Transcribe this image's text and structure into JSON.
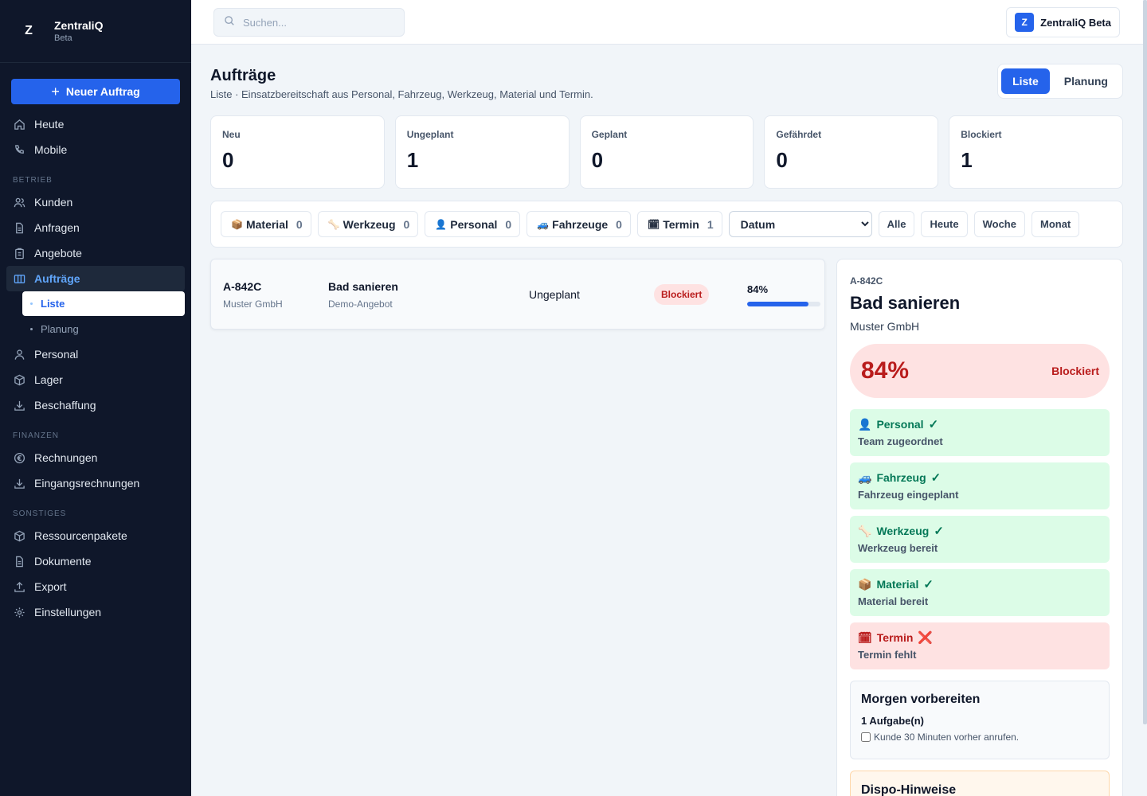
{
  "brand": {
    "logo_letter": "Z",
    "name": "ZentraliQ",
    "sub": "Beta"
  },
  "sidebar": {
    "new_button": "Neuer Auftrag",
    "top_items": [
      {
        "label": "Heute",
        "icon": "home-icon"
      },
      {
        "label": "Mobile",
        "icon": "phone-icon"
      }
    ],
    "sections": [
      {
        "title": "Betrieb",
        "items": [
          "Kunden",
          "Anfragen",
          "Angebote",
          "Aufträge"
        ]
      },
      {
        "title": "Finanzen",
        "items": [
          "Rechnungen",
          "Eingangsrechnungen"
        ]
      },
      {
        "title": "Sonstiges",
        "items": [
          "Ressourcenpakete",
          "Dokumente",
          "Export",
          "Einstellungen"
        ]
      }
    ],
    "subitems": [
      "Liste",
      "Planung"
    ],
    "more_items": [
      "Personal",
      "Lager",
      "Beschaffung"
    ],
    "active_item": "Aufträge",
    "active_subitem": "Liste"
  },
  "topbar": {
    "search_placeholder": "Suchen...",
    "workspace_avatar": "Z",
    "workspace_name": "ZentraliQ Beta"
  },
  "page": {
    "title": "Aufträge",
    "subtitle": "Liste · Einsatzbereitschaft aus Personal, Fahrzeug, Werkzeug, Material und Termin.",
    "view_toggle": [
      "Liste",
      "Planung"
    ],
    "active_view": "Liste"
  },
  "stats": [
    {
      "label": "Neu",
      "value": "0"
    },
    {
      "label": "Ungeplant",
      "value": "1"
    },
    {
      "label": "Geplant",
      "value": "0"
    },
    {
      "label": "Gefährdet",
      "value": "0"
    },
    {
      "label": "Blockiert",
      "value": "1"
    }
  ],
  "filters": {
    "chips": [
      {
        "emoji": "📦",
        "label": "Material",
        "count": "0"
      },
      {
        "emoji": "🦴",
        "label": "Werkzeug",
        "count": "0"
      },
      {
        "emoji": "👤",
        "label": "Personal",
        "count": "0"
      },
      {
        "emoji": "🚙",
        "label": "Fahrzeuge",
        "count": "0"
      },
      {
        "emoji": "🗓",
        "label": "Termin",
        "count": "1"
      }
    ],
    "date_select": "Datum",
    "ranges": [
      "Alle",
      "Heute",
      "Woche",
      "Monat"
    ]
  },
  "orders": [
    {
      "id": "A-842C",
      "customer": "Muster GmbH",
      "title": "Bad sanieren",
      "source": "Demo-Angebot",
      "status": "Ungeplant",
      "badge": "Blockiert",
      "progress_label": "84%",
      "progress": 84
    }
  ],
  "detail": {
    "id": "A-842C",
    "title": "Bad sanieren",
    "customer": "Muster GmbH",
    "score": "84%",
    "score_label": "Blockiert",
    "checks": [
      {
        "emoji": "👤",
        "label": "Personal",
        "mark": "✓",
        "state": "ok",
        "sub": "Team zugeordnet"
      },
      {
        "emoji": "🚙",
        "label": "Fahrzeug",
        "mark": "✓",
        "state": "ok",
        "sub": "Fahrzeug eingeplant"
      },
      {
        "emoji": "🦴",
        "label": "Werkzeug",
        "mark": "✓",
        "state": "ok",
        "sub": "Werkzeug bereit"
      },
      {
        "emoji": "📦",
        "label": "Material",
        "mark": "✓",
        "state": "ok",
        "sub": "Material bereit"
      },
      {
        "emoji": "🗓",
        "label": "Termin",
        "mark": "❌",
        "state": "bad",
        "sub": "Termin fehlt"
      }
    ],
    "prep_title": "Morgen vorbereiten",
    "prep_count": "1 Aufgabe(n)",
    "prep_task": "Kunde 30 Minuten vorher anrufen.",
    "dispo_title": "Dispo-Hinweise"
  },
  "colors": {
    "accent": "#2563eb",
    "sidebar_bg": "#0f172a",
    "danger": "#b91c1c",
    "success": "#047857"
  }
}
